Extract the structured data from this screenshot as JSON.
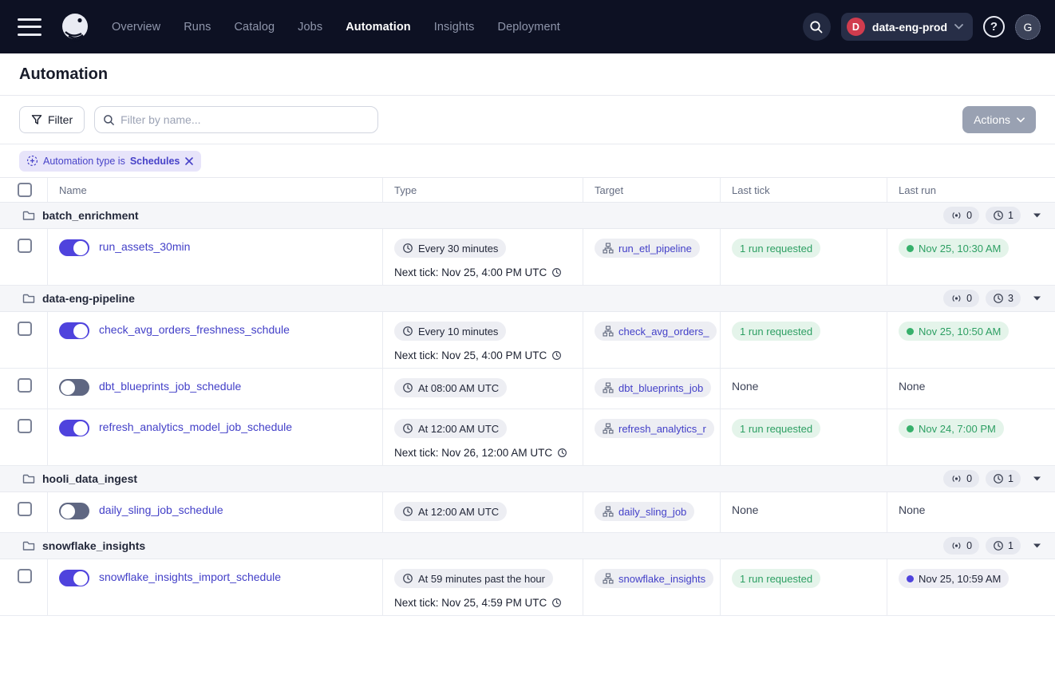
{
  "nav": {
    "items": [
      {
        "label": "Overview",
        "active": false
      },
      {
        "label": "Runs",
        "active": false
      },
      {
        "label": "Catalog",
        "active": false
      },
      {
        "label": "Jobs",
        "active": false
      },
      {
        "label": "Automation",
        "active": true
      },
      {
        "label": "Insights",
        "active": false
      },
      {
        "label": "Deployment",
        "active": false
      }
    ],
    "deployment": {
      "initial": "D",
      "label": "data-eng-prod"
    },
    "user_initial": "G"
  },
  "page": {
    "title": "Automation"
  },
  "toolbar": {
    "filter_label": "Filter",
    "search_placeholder": "Filter by name...",
    "actions_label": "Actions"
  },
  "filter_chip": {
    "prefix": "Automation type is",
    "value": "Schedules"
  },
  "table": {
    "columns": {
      "name": "Name",
      "type": "Type",
      "target": "Target",
      "last_tick": "Last tick",
      "last_run": "Last run"
    },
    "groups": [
      {
        "name": "batch_enrichment",
        "sensor_count": "0",
        "schedule_count": "1",
        "rows": [
          {
            "name": "run_assets_30min",
            "enabled": true,
            "type_pill": "Every 30 minutes",
            "next_tick": "Next tick: Nov 25, 4:00 PM UTC",
            "target": "run_etl_pipeline",
            "last_tick": "1 run requested",
            "last_run": "Nov 25, 10:30 AM",
            "last_run_status": "success"
          }
        ]
      },
      {
        "name": "data-eng-pipeline",
        "sensor_count": "0",
        "schedule_count": "3",
        "rows": [
          {
            "name": "check_avg_orders_freshness_schdule",
            "enabled": true,
            "type_pill": "Every 10 minutes",
            "next_tick": "Next tick: Nov 25, 4:00 PM UTC",
            "target": "check_avg_orders_",
            "last_tick": "1 run requested",
            "last_run": "Nov 25, 10:50 AM",
            "last_run_status": "success"
          },
          {
            "name": "dbt_blueprints_job_schedule",
            "enabled": false,
            "type_pill": "At 08:00 AM UTC",
            "next_tick": "",
            "target": "dbt_blueprints_job",
            "last_tick": "None",
            "last_run": "None",
            "last_run_status": "none"
          },
          {
            "name": "refresh_analytics_model_job_schedule",
            "enabled": true,
            "type_pill": "At 12:00 AM UTC",
            "next_tick": "Next tick: Nov 26, 12:00 AM UTC",
            "target": "refresh_analytics_r",
            "last_tick": "1 run requested",
            "last_run": "Nov 24, 7:00 PM",
            "last_run_status": "success"
          }
        ]
      },
      {
        "name": "hooli_data_ingest",
        "sensor_count": "0",
        "schedule_count": "1",
        "rows": [
          {
            "name": "daily_sling_job_schedule",
            "enabled": false,
            "type_pill": "At 12:00 AM UTC",
            "next_tick": "",
            "target": "daily_sling_job",
            "last_tick": "None",
            "last_run": "None",
            "last_run_status": "none"
          }
        ]
      },
      {
        "name": "snowflake_insights",
        "sensor_count": "0",
        "schedule_count": "1",
        "rows": [
          {
            "name": "snowflake_insights_import_schedule",
            "enabled": true,
            "type_pill": "At 59 minutes past the hour",
            "next_tick": "Next tick: Nov 25, 4:59 PM UTC",
            "target": "snowflake_insights",
            "last_tick": "1 run requested",
            "last_run": "Nov 25, 10:59 AM",
            "last_run_status": "started"
          }
        ]
      }
    ]
  },
  "colors": {
    "nav_bg": "#0d1123",
    "accent_indigo": "#4f43dd",
    "link_indigo": "#4340c8",
    "success_green": "#2d9f63",
    "success_dot": "#36b06b",
    "started_dot": "#4f43dd",
    "deploy_avatar_red": "#d13c4e",
    "chip_bg": "#e7e4fa",
    "group_bg": "#f5f6f9"
  }
}
